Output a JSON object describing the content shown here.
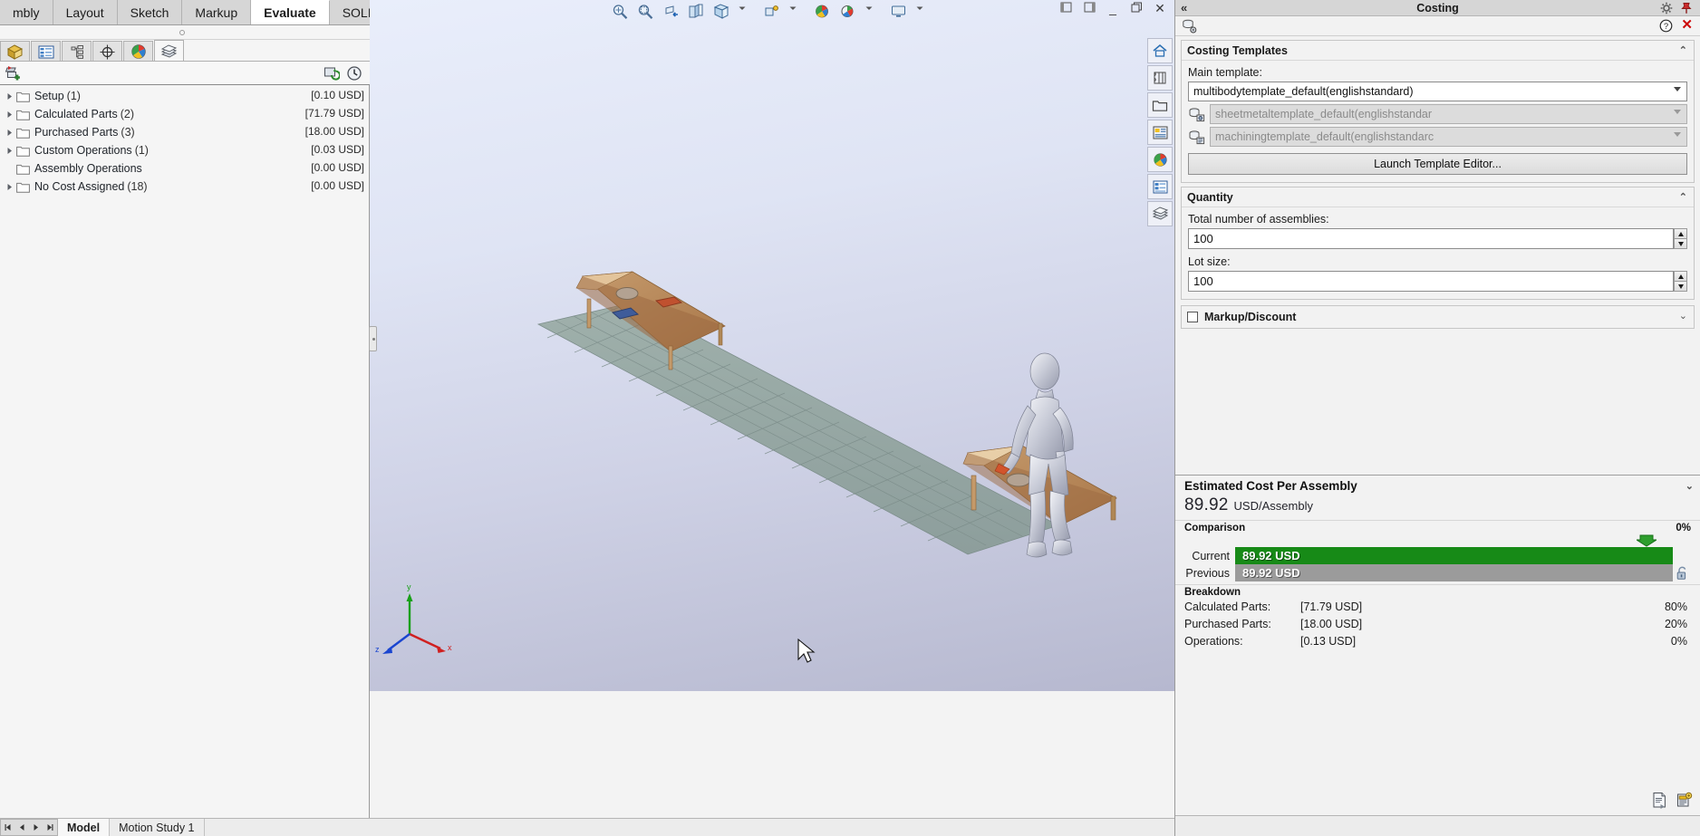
{
  "command_manager": {
    "tabs": [
      {
        "label": "mbly",
        "active": false
      },
      {
        "label": "Layout",
        "active": false
      },
      {
        "label": "Sketch",
        "active": false
      },
      {
        "label": "Markup",
        "active": false
      },
      {
        "label": "Evaluate",
        "active": true
      },
      {
        "label": "SOLIDWORKS Add-Ins",
        "active": false
      }
    ]
  },
  "manager_tabs": [
    {
      "name": "feature-manager-design-tree-tab",
      "icon": "feature-tree-icon"
    },
    {
      "name": "property-manager-tab",
      "icon": "property-list-icon"
    },
    {
      "name": "configuration-manager-tab",
      "icon": "configuration-icon"
    },
    {
      "name": "dimxpert-manager-tab",
      "icon": "dimxpert-target-icon"
    },
    {
      "name": "display-manager-tab",
      "icon": "display-sphere-icon"
    },
    {
      "name": "costing-manager-tab",
      "icon": "costing-stack-icon",
      "active": true
    }
  ],
  "tree": {
    "toolbar_icon": "add-costing-task-icon",
    "right_icons": [
      "refresh-costing-icon",
      "cost-history-icon"
    ],
    "rows": [
      {
        "label": "Setup",
        "count": "(1)",
        "cost": "[0.10 USD]",
        "expandable": true
      },
      {
        "label": "Calculated Parts",
        "count": "(2)",
        "cost": "[71.79 USD]",
        "expandable": true
      },
      {
        "label": "Purchased Parts",
        "count": "(3)",
        "cost": "[18.00 USD]",
        "expandable": true
      },
      {
        "label": "Custom Operations",
        "count": "(1)",
        "cost": "[0.03 USD]",
        "expandable": true
      },
      {
        "label": "Assembly Operations",
        "count": "",
        "cost": "[0.00 USD]",
        "expandable": false
      },
      {
        "label": "No Cost Assigned",
        "count": "(18)",
        "cost": "[0.00 USD]",
        "expandable": true
      }
    ]
  },
  "bottom_tabs": [
    {
      "label": "Model",
      "active": true
    },
    {
      "label": "Motion Study 1",
      "active": false
    }
  ],
  "viewport": {
    "toolbar_icons": [
      "zoom-to-area-icon",
      "zoom-to-fit-icon",
      "section-view-icon",
      "view-orientation-icon",
      "display-style-icon",
      "hide-show-items-icon",
      "edit-appearance-icon",
      "apply-scene-icon",
      "view-settings-icon"
    ],
    "window_buttons": [
      "restore-left-icon",
      "restore-right-icon",
      "minimize-icon",
      "restore-icon",
      "close-icon"
    ],
    "right_toolbar_icons": [
      "home-icon",
      "display-pane-icon",
      "open-folder-icon",
      "layout-icon",
      "appearance-sphere-icon",
      "task-list-icon",
      "costing-stack-icon"
    ],
    "triad_labels": {
      "x": "x",
      "y": "y",
      "z": "z"
    }
  },
  "costing_panel": {
    "title": "Costing",
    "collapse_icon": "double-chevron-left-icon",
    "gear_icon": "gear-icon",
    "pin_icon": "pushpin-icon",
    "tool_icon": "costing-options-icon",
    "help_icon": "help-icon",
    "close_label": "✕",
    "templates": {
      "header": "Costing Templates",
      "main_template_label": "Main template:",
      "main_template_value": "multibodytemplate_default(englishstandard)",
      "sub_templates": [
        {
          "icon": "sheetmetal-template-icon",
          "value": "sheetmetaltemplate_default(englishstandar"
        },
        {
          "icon": "machining-template-icon",
          "value": "machiningtemplate_default(englishstandarc"
        }
      ],
      "launch_button": "Launch Template Editor..."
    },
    "quantity": {
      "header": "Quantity",
      "total_label": "Total number of assemblies:",
      "total_value": "100",
      "lot_label": "Lot size:",
      "lot_value": "100"
    },
    "markup": {
      "header": "Markup/Discount",
      "checked": false
    },
    "estimated_cost": {
      "header": "Estimated Cost Per Assembly",
      "value": "89.92",
      "unit": "USD/Assembly",
      "comparison_label": "Comparison",
      "comparison_pct": "0%",
      "comparison_color": "#178a17",
      "rows": [
        {
          "label": "Current",
          "value": "89.92 USD",
          "state": "current"
        },
        {
          "label": "Previous",
          "value": "89.92 USD",
          "state": "previous"
        }
      ],
      "lock_icon": "unlock-icon",
      "breakdown_label": "Breakdown",
      "breakdown": [
        {
          "name": "Calculated Parts:",
          "cost": "[71.79 USD]",
          "pct": "80%"
        },
        {
          "name": "Purchased Parts:",
          "cost": "[18.00 USD]",
          "pct": "20%"
        },
        {
          "name": "Operations:",
          "cost": "[0.13 USD]",
          "pct": "0%"
        }
      ],
      "footer_icons": [
        "generate-report-icon",
        "cost-estimate-template-icon"
      ]
    }
  }
}
